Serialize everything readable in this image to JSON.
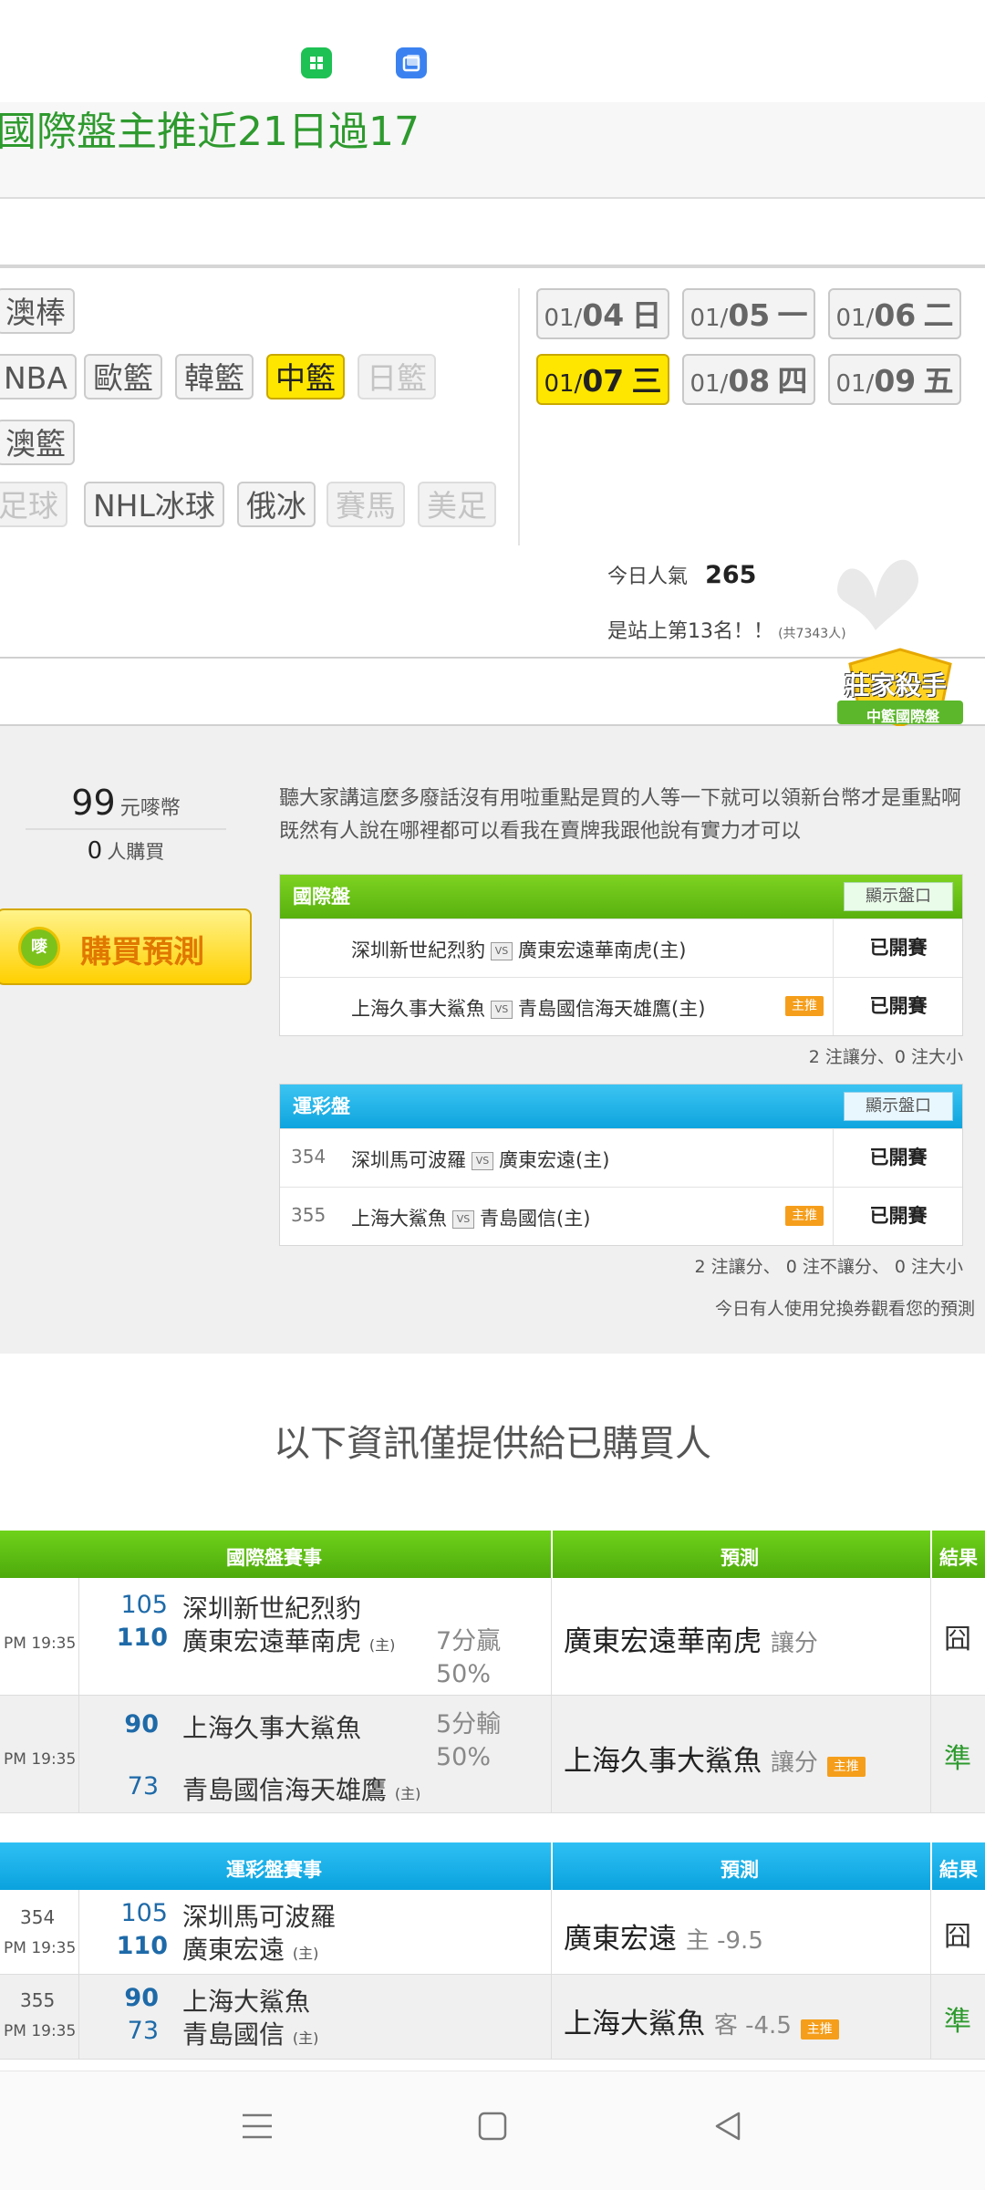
{
  "header": {
    "title": "國際盤主推近21日過17"
  },
  "categories": {
    "row1": [
      "澳棒"
    ],
    "row2": [
      "NBA",
      "歐籃",
      "韓籃",
      "中籃",
      "日籃"
    ],
    "row3": [
      "澳籃"
    ],
    "row4": [
      "足球",
      "NHL冰球",
      "俄冰",
      "賽馬",
      "美足"
    ],
    "active": "中籃",
    "disabled": [
      "日籃",
      "足球",
      "賽馬",
      "美足"
    ]
  },
  "dates": [
    {
      "md": "01/",
      "d": "04",
      "wd": "日"
    },
    {
      "md": "01/",
      "d": "05",
      "wd": "一"
    },
    {
      "md": "01/",
      "d": "06",
      "wd": "二"
    },
    {
      "md": "01/",
      "d": "07",
      "wd": "三",
      "active": true
    },
    {
      "md": "01/",
      "d": "08",
      "wd": "四"
    },
    {
      "md": "01/",
      "d": "09",
      "wd": "五"
    }
  ],
  "popularity": {
    "label": "今日人氣",
    "value": "265",
    "rank_text": "是站上第13名！！",
    "total": "(共7343人)"
  },
  "badge": {
    "line1": "莊家殺手",
    "line2": "中籃國際盤"
  },
  "price": {
    "amount": "99",
    "unit": "元嘜幣",
    "buyers": "0",
    "buyers_label": "人購買"
  },
  "buy_button": {
    "label": "購買預測",
    "coin": "嘜"
  },
  "description": "聽大家講這麼多廢話沒有用啦重點是買的人等一下就可以領新台幣才是重點啊既然有人說在哪裡都可以看我在賣牌我跟他說有實力才可以",
  "intl_table": {
    "title": "國際盤",
    "show_label": "顯示盤口",
    "rows": [
      {
        "no": "",
        "away": "深圳新世紀烈豹",
        "home": "廣東宏遠華南虎(主)",
        "tag": "",
        "status": "已開賽"
      },
      {
        "no": "",
        "away": "上海久事大鯊魚",
        "home": "青島國信海天雄鷹(主)",
        "tag": "主推",
        "status": "已開賽"
      }
    ],
    "summary": "2 注讓分、0 注大小"
  },
  "lottery_table": {
    "title": "運彩盤",
    "show_label": "顯示盤口",
    "rows": [
      {
        "no": "354",
        "away": "深圳馬可波羅",
        "home": "廣東宏遠(主)",
        "tag": "",
        "status": "已開賽"
      },
      {
        "no": "355",
        "away": "上海大鯊魚",
        "home": "青島國信(主)",
        "tag": "主推",
        "status": "已開賽"
      }
    ],
    "summary": "2 注讓分、 0 注不讓分、 0 注大小",
    "note": "今日有人使用兌換券觀看您的預測"
  },
  "vs_label": "VS",
  "info_title": "以下資訊僅提供給已購買人",
  "bottom_intl": {
    "header": {
      "event": "國際盤賽事",
      "pred": "預測",
      "result": "結果"
    },
    "rows": [
      {
        "time": "PM 19:35",
        "s1": "105",
        "t1": "深圳新世紀烈豹",
        "s2": "110",
        "t2": "廣東宏遠華南虎",
        "host": "(主)",
        "diff1": "7分贏",
        "diff2": "50%",
        "pred": "廣東宏遠華南虎",
        "pred_type": "讓分",
        "tag": "",
        "result": "囧"
      },
      {
        "time": "PM 19:35",
        "s1": "90",
        "t1": "上海久事大鯊魚",
        "s2": "73",
        "t2": "青島國信海天雄鷹",
        "host": "(主)",
        "diff1": "5分輸",
        "diff2": "50%",
        "pred": "上海久事大鯊魚",
        "pred_type": "讓分",
        "tag": "主推",
        "result": "準"
      }
    ]
  },
  "bottom_lottery": {
    "header": {
      "event": "運彩盤賽事",
      "pred": "預測",
      "result": "結果"
    },
    "rows": [
      {
        "no": "354",
        "time": "PM 19:35",
        "s1": "105",
        "t1": "深圳馬可波羅",
        "s2": "110",
        "t2": "廣東宏遠",
        "host": "(主)",
        "pred": "廣東宏遠",
        "pred_type": "主 -9.5",
        "tag": "",
        "result": "囧"
      },
      {
        "no": "355",
        "time": "PM 19:35",
        "s1": "90",
        "t1": "上海大鯊魚",
        "s2": "73",
        "t2": "青島國信",
        "host": "(主)",
        "pred": "上海大鯊魚",
        "pred_type": "客 -4.5",
        "tag": "主推",
        "result": "準"
      }
    ]
  },
  "colors": {
    "green_text": "#2e9a2e",
    "accent_yellow": "#ffe600",
    "result_green": "#2e9a2e"
  }
}
